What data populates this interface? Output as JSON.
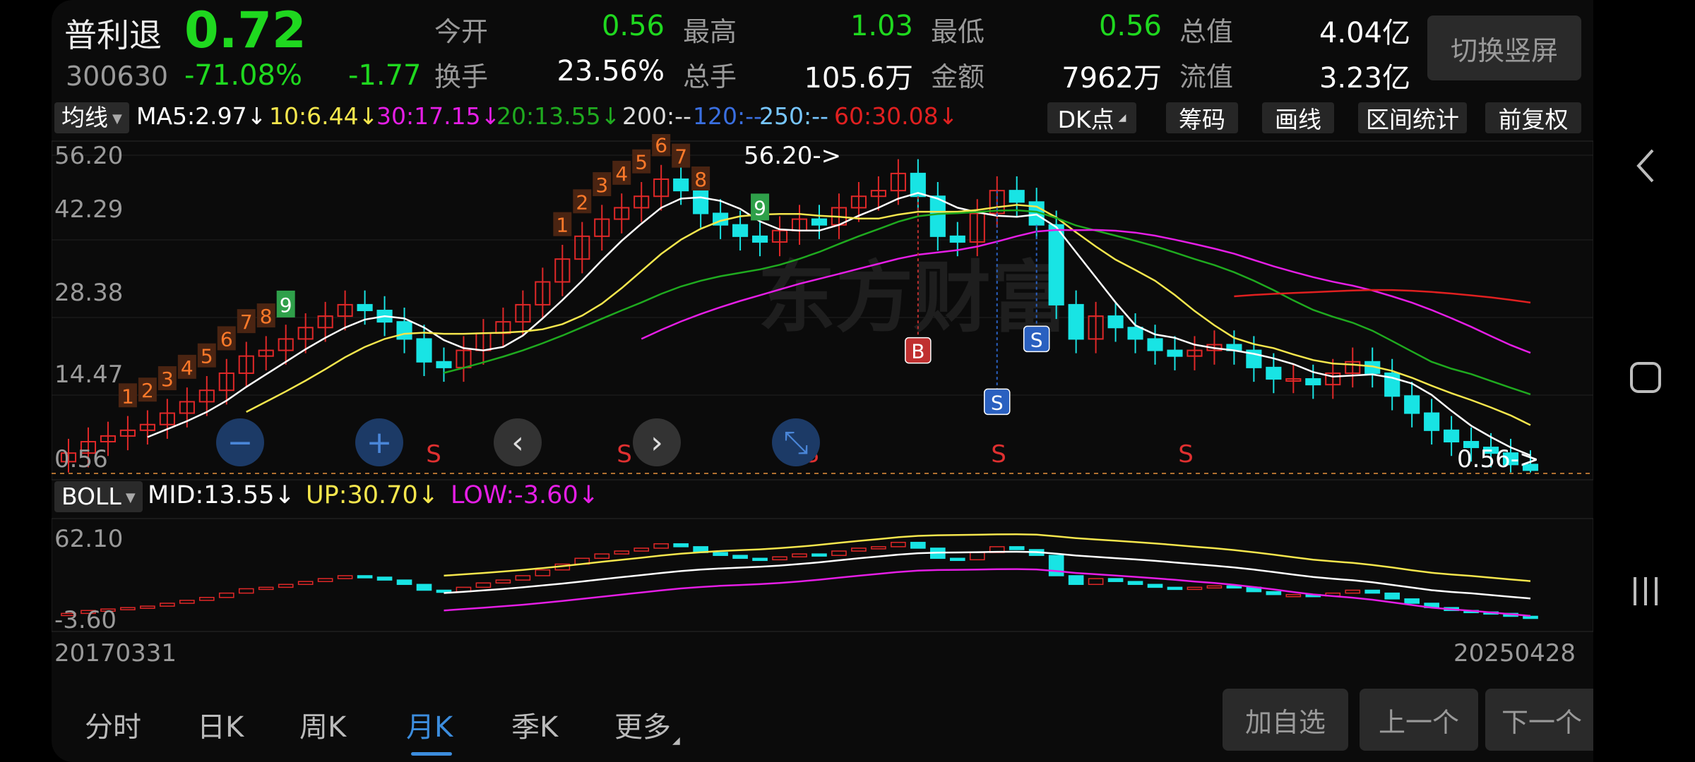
{
  "stock": {
    "name": "普利退",
    "price": "0.72",
    "code": "300630",
    "change_pct": "-71.08%",
    "change": "-1.77"
  },
  "stats": [
    {
      "label": "今开",
      "value": "0.56",
      "color": "green"
    },
    {
      "label": "最高",
      "value": "1.03",
      "color": "green"
    },
    {
      "label": "最低",
      "value": "0.56",
      "color": "green"
    },
    {
      "label": "总值",
      "value": "4.04亿",
      "color": "white"
    },
    {
      "label": "换手",
      "value": "23.56%",
      "color": "white"
    },
    {
      "label": "总手",
      "value": "105.6万",
      "color": "white"
    },
    {
      "label": "金额",
      "value": "7962万",
      "color": "white"
    },
    {
      "label": "流值",
      "value": "3.23亿",
      "color": "white"
    }
  ],
  "switch_label": "切换竖屏",
  "indicator": {
    "main_dropdown": "均线",
    "ma": [
      {
        "text": "MA5:2.97",
        "color": "#ffffff",
        "arrow": "↓"
      },
      {
        "text": "10:6.44",
        "color": "#f5e64d",
        "arrow": "↓"
      },
      {
        "text": "30:17.15",
        "color": "#e51ee5",
        "arrow": "↓"
      },
      {
        "text": "20:13.55",
        "color": "#1faa1f",
        "arrow": "↓"
      },
      {
        "text": "200:--",
        "color": "#dddddd",
        "arrow": ""
      },
      {
        "text": "120:--",
        "color": "#3a6fe0",
        "arrow": ""
      },
      {
        "text": "250:--",
        "color": "#77c6ff",
        "arrow": ""
      },
      {
        "text": "60:30.08",
        "color": "#e02020",
        "arrow": "↓"
      }
    ],
    "tools": [
      "DK点",
      "筹码",
      "画线",
      "区间统计",
      "前复权"
    ]
  },
  "axis": {
    "main_ticks": [
      "56.20",
      "42.29",
      "28.38",
      "14.47",
      "0.56"
    ],
    "sub_ticks": [
      "62.10",
      "-3.60"
    ]
  },
  "annotations": {
    "high_label": "56.20->",
    "low_label": "0.56->",
    "buy": "B",
    "sell": "S",
    "watermark": "东方财富"
  },
  "boll": {
    "dropdown": "BOLL",
    "mid": "MID:13.55",
    "up": "UP:30.70",
    "low": "LOW:-3.60",
    "arrow": "↓"
  },
  "dates": {
    "start": "20170331",
    "end": "20250428"
  },
  "tabs": [
    "分时",
    "日K",
    "周K",
    "月K",
    "季K",
    "更多"
  ],
  "active_tab": "月K",
  "actions": [
    "加自选",
    "上一个",
    "下一个"
  ],
  "chart_data": {
    "type": "candlestick",
    "period": "monthly",
    "ylim": [
      0.56,
      56.2
    ],
    "monthly_close": [
      4,
      6,
      7,
      8,
      9,
      11,
      13,
      15,
      18,
      21,
      22,
      24,
      26,
      28,
      30,
      29,
      27,
      24,
      20,
      19,
      22,
      25,
      27,
      30,
      34,
      38,
      42,
      45,
      47,
      49,
      52,
      50,
      46,
      44,
      42,
      41,
      43,
      45,
      44,
      47,
      49,
      50,
      53,
      49,
      42,
      41,
      46,
      50,
      48,
      44,
      30,
      24,
      28,
      26,
      24,
      22,
      21,
      22,
      23,
      22,
      19,
      17,
      17,
      16,
      18,
      20,
      18,
      14,
      11,
      8,
      6,
      5,
      4,
      2,
      1
    ]
  }
}
